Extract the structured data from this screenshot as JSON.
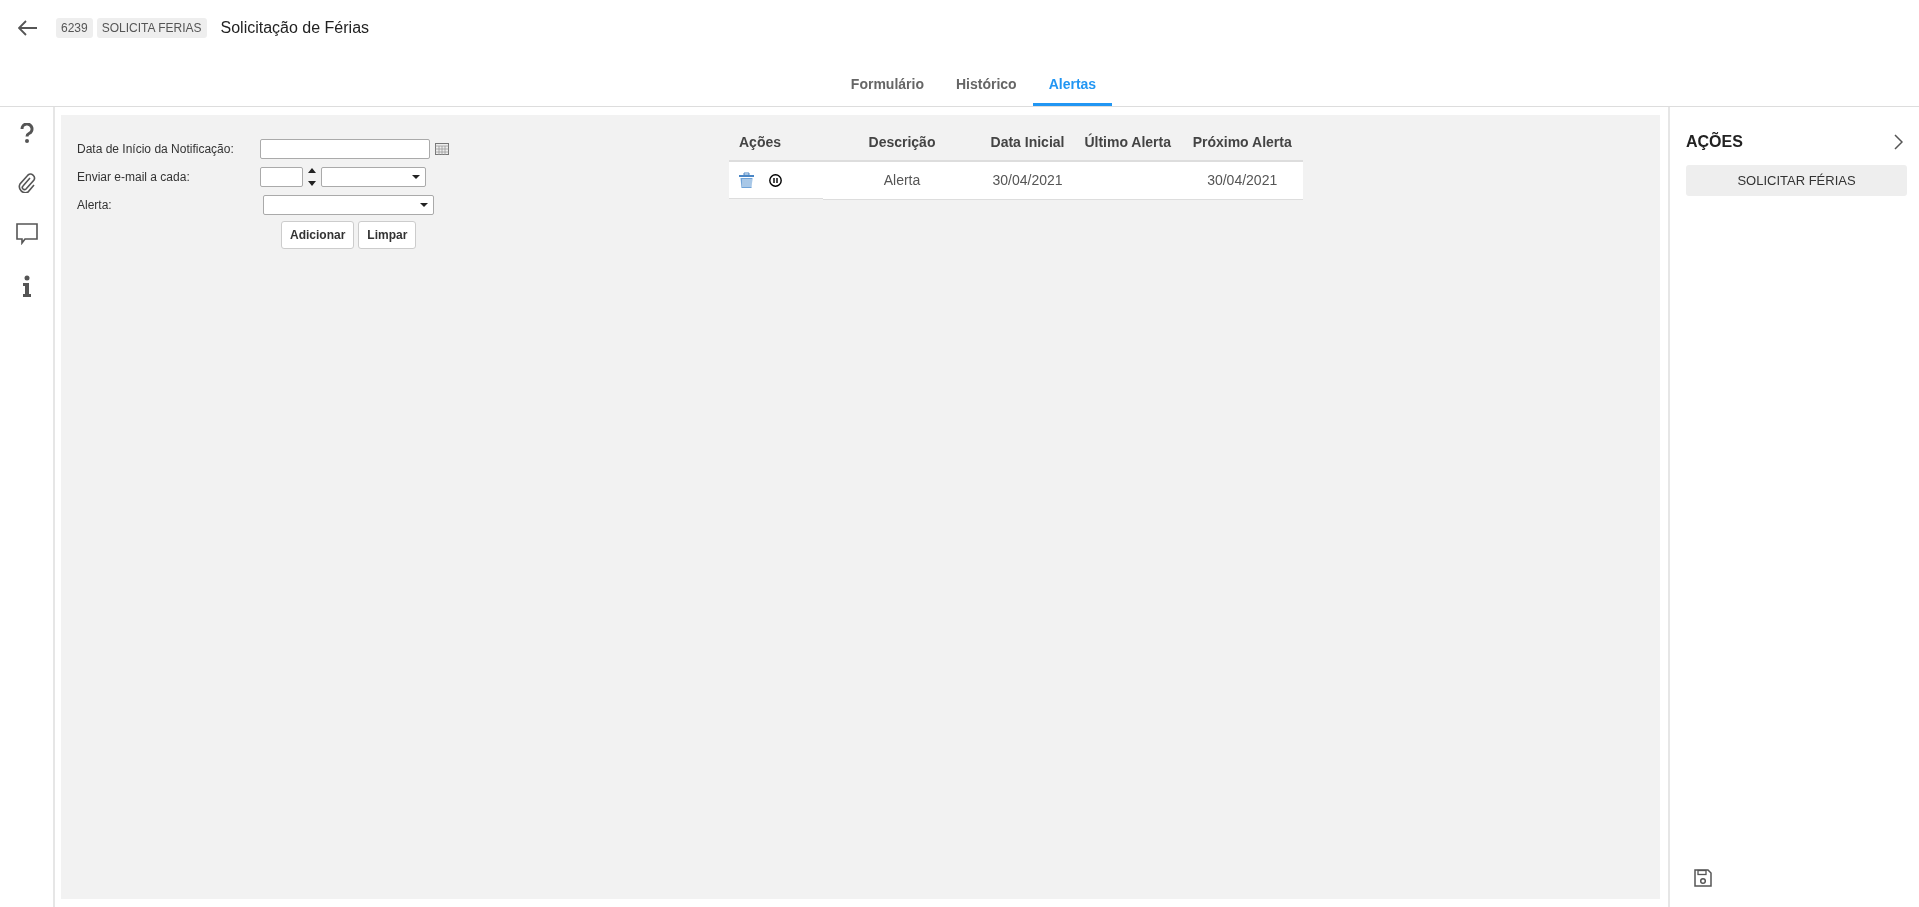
{
  "header": {
    "badges": [
      "6239",
      "SOLICITA FERIAS"
    ],
    "title": "Solicitação de Férias"
  },
  "tabs": [
    {
      "label": "Formulário",
      "selected": false
    },
    {
      "label": "Histórico",
      "selected": false
    },
    {
      "label": "Alertas",
      "selected": true
    }
  ],
  "form": {
    "fields": [
      {
        "label": "Data de Início da Notificação:",
        "kind": "date"
      },
      {
        "label": "Enviar e-mail a cada:",
        "kind": "interval"
      },
      {
        "label": "Alerta:",
        "kind": "select"
      }
    ],
    "buttons": [
      "Adicionar",
      "Limpar"
    ]
  },
  "table": {
    "columns": [
      "Ações",
      "Descrição",
      "Data Inicial",
      "Último Alerta",
      "Próximo Alerta"
    ],
    "rows": [
      {
        "cells": [
          "",
          "Alerta",
          "30/04/2021",
          "",
          "30/04/2021"
        ]
      }
    ]
  },
  "actions_panel": {
    "title": "AÇÕES",
    "buttons": [
      "SOLICITAR FÉRIAS"
    ]
  }
}
